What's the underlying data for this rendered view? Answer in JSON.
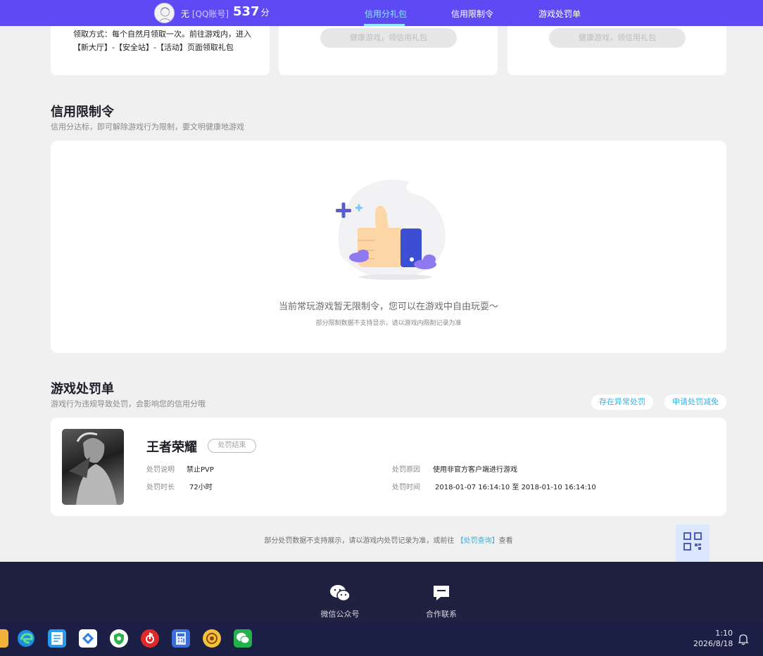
{
  "header": {
    "user_name": "无",
    "account_type": "[QQ账号]",
    "score": "537",
    "score_unit": "分",
    "tabs": [
      {
        "label": "信用分礼包",
        "active": true
      },
      {
        "label": "信用限制令",
        "active": false
      },
      {
        "label": "游戏处罚单",
        "active": false
      }
    ]
  },
  "gift_cards": {
    "card1_text": "领取方式：每个自然月领取一次。前往游戏内，进入【新大厅】-【安全站】-【活动】页面领取礼包",
    "card2_button": "健康游戏，领信用礼包",
    "card3_button": "健康游戏，领信用礼包"
  },
  "restriction": {
    "title": "信用限制令",
    "subtitle": "信用分达标，即可解除游戏行为限制，要文明健康地游戏",
    "empty_message": "当前常玩游戏暂无限制令，您可以在游戏中自由玩耍～",
    "note": "部分限制数据不支持显示，请以游戏内限制记录为准"
  },
  "punishment": {
    "title": "游戏处罚单",
    "subtitle": "游戏行为违规导致处罚，会影响您的信用分哦",
    "report_button": "存在异常处罚",
    "appeal_button": "申请处罚减免",
    "record": {
      "game_name": "王者荣耀",
      "status": "处罚结束",
      "desc_label": "处罚说明",
      "desc_value": "禁止PVP",
      "duration_label": "处罚时长",
      "duration_value": "72小时",
      "reason_label": "处罚原因",
      "reason_value": "使用非官方客户端进行游戏",
      "time_label": "处罚时间",
      "time_value": "2018-01-07 16:14:10 至 2018-01-10 16:14:10"
    },
    "footnote_before": "部分处罚数据不支持展示，请以游戏内处罚记录为准，或前往 ",
    "footnote_link": "【处罚查询】",
    "footnote_after": "查看"
  },
  "footer": {
    "wechat_label": "微信公众号",
    "contact_label": "合作联系"
  },
  "taskbar": {
    "time": "1:10",
    "date": "2026/8/18"
  },
  "colors": {
    "brand": "#5d4af5",
    "accent": "#33b1e6",
    "footer_bg": "#202040"
  }
}
